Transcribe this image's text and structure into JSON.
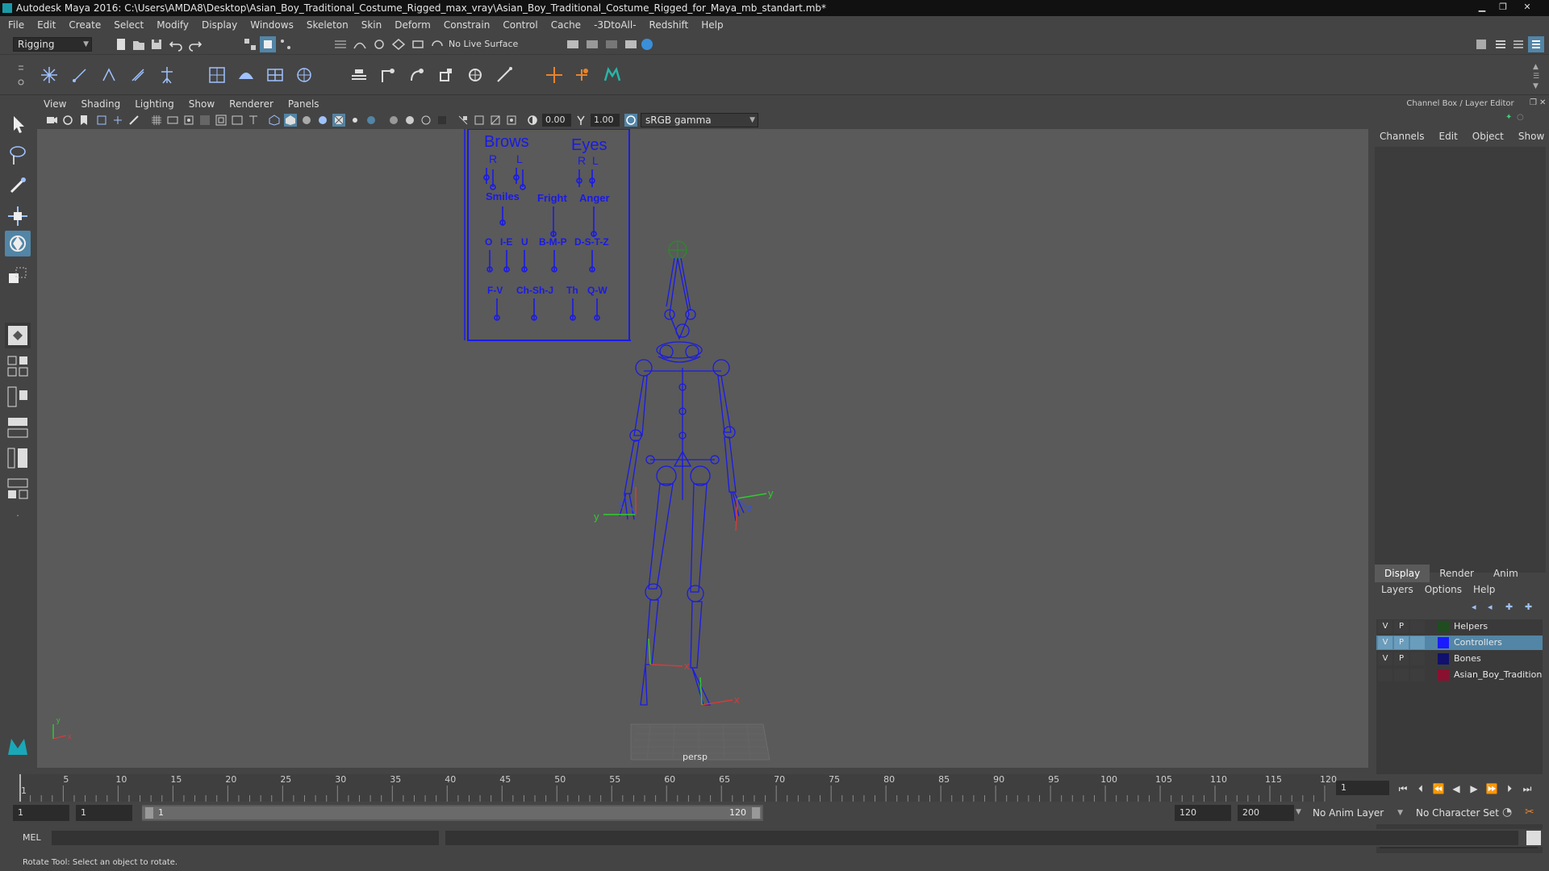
{
  "window": {
    "title": "Autodesk Maya 2016: C:\\Users\\AMDA8\\Desktop\\Asian_Boy_Traditional_Costume_Rigged_max_vray\\Asian_Boy_Traditional_Costume_Rigged_for_Maya_mb_standart.mb*"
  },
  "menubar": [
    "File",
    "Edit",
    "Create",
    "Select",
    "Modify",
    "Display",
    "Windows",
    "Skeleton",
    "Skin",
    "Deform",
    "Constrain",
    "Control",
    "Cache",
    "-3DtoAll-",
    "Redshift",
    "Help"
  ],
  "statusline": {
    "menuset": "Rigging",
    "live_surface": "No Live Surface"
  },
  "viewport": {
    "menu": [
      "View",
      "Shading",
      "Lighting",
      "Show",
      "Renderer",
      "Panels"
    ],
    "exposure": "0.00",
    "gamma": "1.00",
    "colorspace": "sRGB gamma",
    "camera_label": "persp"
  },
  "face_ui": {
    "brows": "Brows",
    "eyes": "Eyes",
    "r": "R",
    "l": "L",
    "smiles": "Smiles",
    "fright": "Fright",
    "anger": "Anger",
    "o": "O",
    "he": "I-E",
    "u": "U",
    "bmp": "B-M-P",
    "dstz": "D-S-T-Z",
    "fv": "F-V",
    "chshj": "Ch-Sh-J",
    "th": "Th",
    "qw": "Q-W"
  },
  "right_panel": {
    "title": "Channel Box / Layer Editor",
    "cb_menu": [
      "Channels",
      "Edit",
      "Object",
      "Show"
    ],
    "layer_tabs": [
      "Display",
      "Render",
      "Anim"
    ],
    "layer_menu": [
      "Layers",
      "Options",
      "Help"
    ],
    "layers": [
      {
        "v": "V",
        "p": "P",
        "name": "Helpers",
        "color": "#1f4d1f"
      },
      {
        "v": "V",
        "p": "P",
        "name": "Controllers",
        "color": "#1a1aff"
      },
      {
        "v": "V",
        "p": "P",
        "name": "Bones",
        "color": "#10106e"
      },
      {
        "v": "",
        "p": "",
        "name": "Asian_Boy_Traditional_",
        "color": "#8a1030"
      }
    ]
  },
  "timeline": {
    "ticks": [
      "5",
      "10",
      "15",
      "20",
      "25",
      "30",
      "35",
      "40",
      "45",
      "50",
      "55",
      "60",
      "65",
      "70",
      "75",
      "80",
      "85",
      "90",
      "95",
      "100",
      "105",
      "110",
      "115",
      "120"
    ],
    "ruler_start": "1",
    "current_frame": "1"
  },
  "range": {
    "start": "1",
    "playback_start": "1",
    "range_start_label": "1",
    "range_end_label": "120",
    "playback_end": "120",
    "end": "200",
    "anim_layer": "No Anim Layer",
    "character_set": "No Character Set"
  },
  "commandline": {
    "label": "MEL"
  },
  "helpline": {
    "text": "Rotate Tool: Select an object to rotate."
  },
  "colors": {
    "rig_blue": "#1a1ae6",
    "viewport_bg": "#5a5a5a",
    "selection": "#5285a6"
  }
}
